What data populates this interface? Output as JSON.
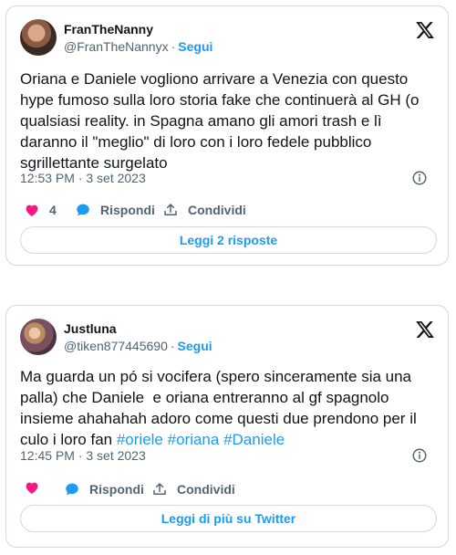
{
  "tweets": [
    {
      "display_name": "FranTheNanny",
      "handle": "@FranTheNannyx",
      "separator": "·",
      "follow_label": "Segui",
      "text": "Oriana e Daniele vogliono arrivare a Venezia con questo hype fumoso sulla loro storia fake che continuerà al GH (o qualsiasi reality. in Spagna amano gli amori trash e lì daranno il \"meglio\" di loro con i loro fedele pubblico sgrillettante surgelato",
      "timestamp": "12:53 PM · 3 set 2023",
      "like_count": "4",
      "reply_label": "Rispondi",
      "share_label": "Condividi",
      "cta_label": "Leggi 2 risposte",
      "avatar_icon": "profile-photo"
    },
    {
      "display_name": "Justluna",
      "handle": "@tiken877445690",
      "separator": "·",
      "follow_label": "Segui",
      "text": "Ma guarda un pó si vocifera (spero sinceramente sia una palla) che Daniele  e oriana entreranno al gf spagnolo insieme ahahahah adoro come questi due prendono per il culo i loro fan ",
      "hashtags": [
        "#oriele",
        "#oriana",
        "#Daniele"
      ],
      "timestamp": "12:45 PM · 3 set 2023",
      "like_count": "",
      "reply_label": "Rispondi",
      "share_label": "Condividi",
      "cta_label": "Leggi di più su Twitter",
      "avatar_icon": "profile-photo"
    }
  ],
  "icons": {
    "brand": "x-logo-icon",
    "info": "info-icon",
    "like": "heart-icon",
    "reply": "speech-bubble-icon",
    "share": "share-upload-icon"
  },
  "colors": {
    "accent": "#1d9bf0",
    "like": "#f91880",
    "text": "#0f1419",
    "muted": "#536471",
    "border": "#cfd9de"
  }
}
